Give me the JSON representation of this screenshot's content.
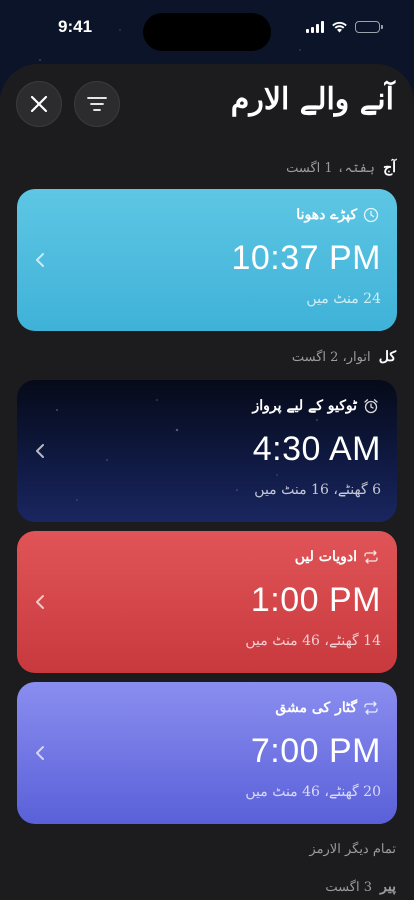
{
  "status": {
    "time": "9:41"
  },
  "sheet": {
    "title": "آنے والے الارم",
    "close_icon": "close-icon",
    "menu_icon": "filter-menu-icon"
  },
  "sections": [
    {
      "day": "آج",
      "date": "ہفتہ، 1 اگست"
    },
    {
      "day": "کل",
      "date": "اتوار، 2 اگست"
    },
    {
      "day": "",
      "date": "تمام دیگر الارمز"
    },
    {
      "day": "پیر",
      "date": "3 اگست"
    }
  ],
  "alarms": [
    {
      "title": "کپڑے دھونا",
      "time": "10:37 PM",
      "remaining": "24 منٹ میں",
      "icon": "clock-icon",
      "color": "#4fbfe0"
    },
    {
      "title": "ٹوکیو کے لیے پرواز",
      "time": "4:30 AM",
      "remaining": "6 گھنٹے، 16 منٹ میں",
      "icon": "alarm-clock-icon",
      "color": "#0a1230"
    },
    {
      "title": "ادویات لیں",
      "time": "1:00 PM",
      "remaining": "14 گھنٹے، 46 منٹ میں",
      "icon": "repeat-icon",
      "color": "#d6474b"
    },
    {
      "title": "گٹار کی مشق",
      "time": "7:00 PM",
      "remaining": "20 گھنٹے، 46 منٹ میں",
      "icon": "repeat-icon",
      "color": "#7377e6"
    }
  ]
}
